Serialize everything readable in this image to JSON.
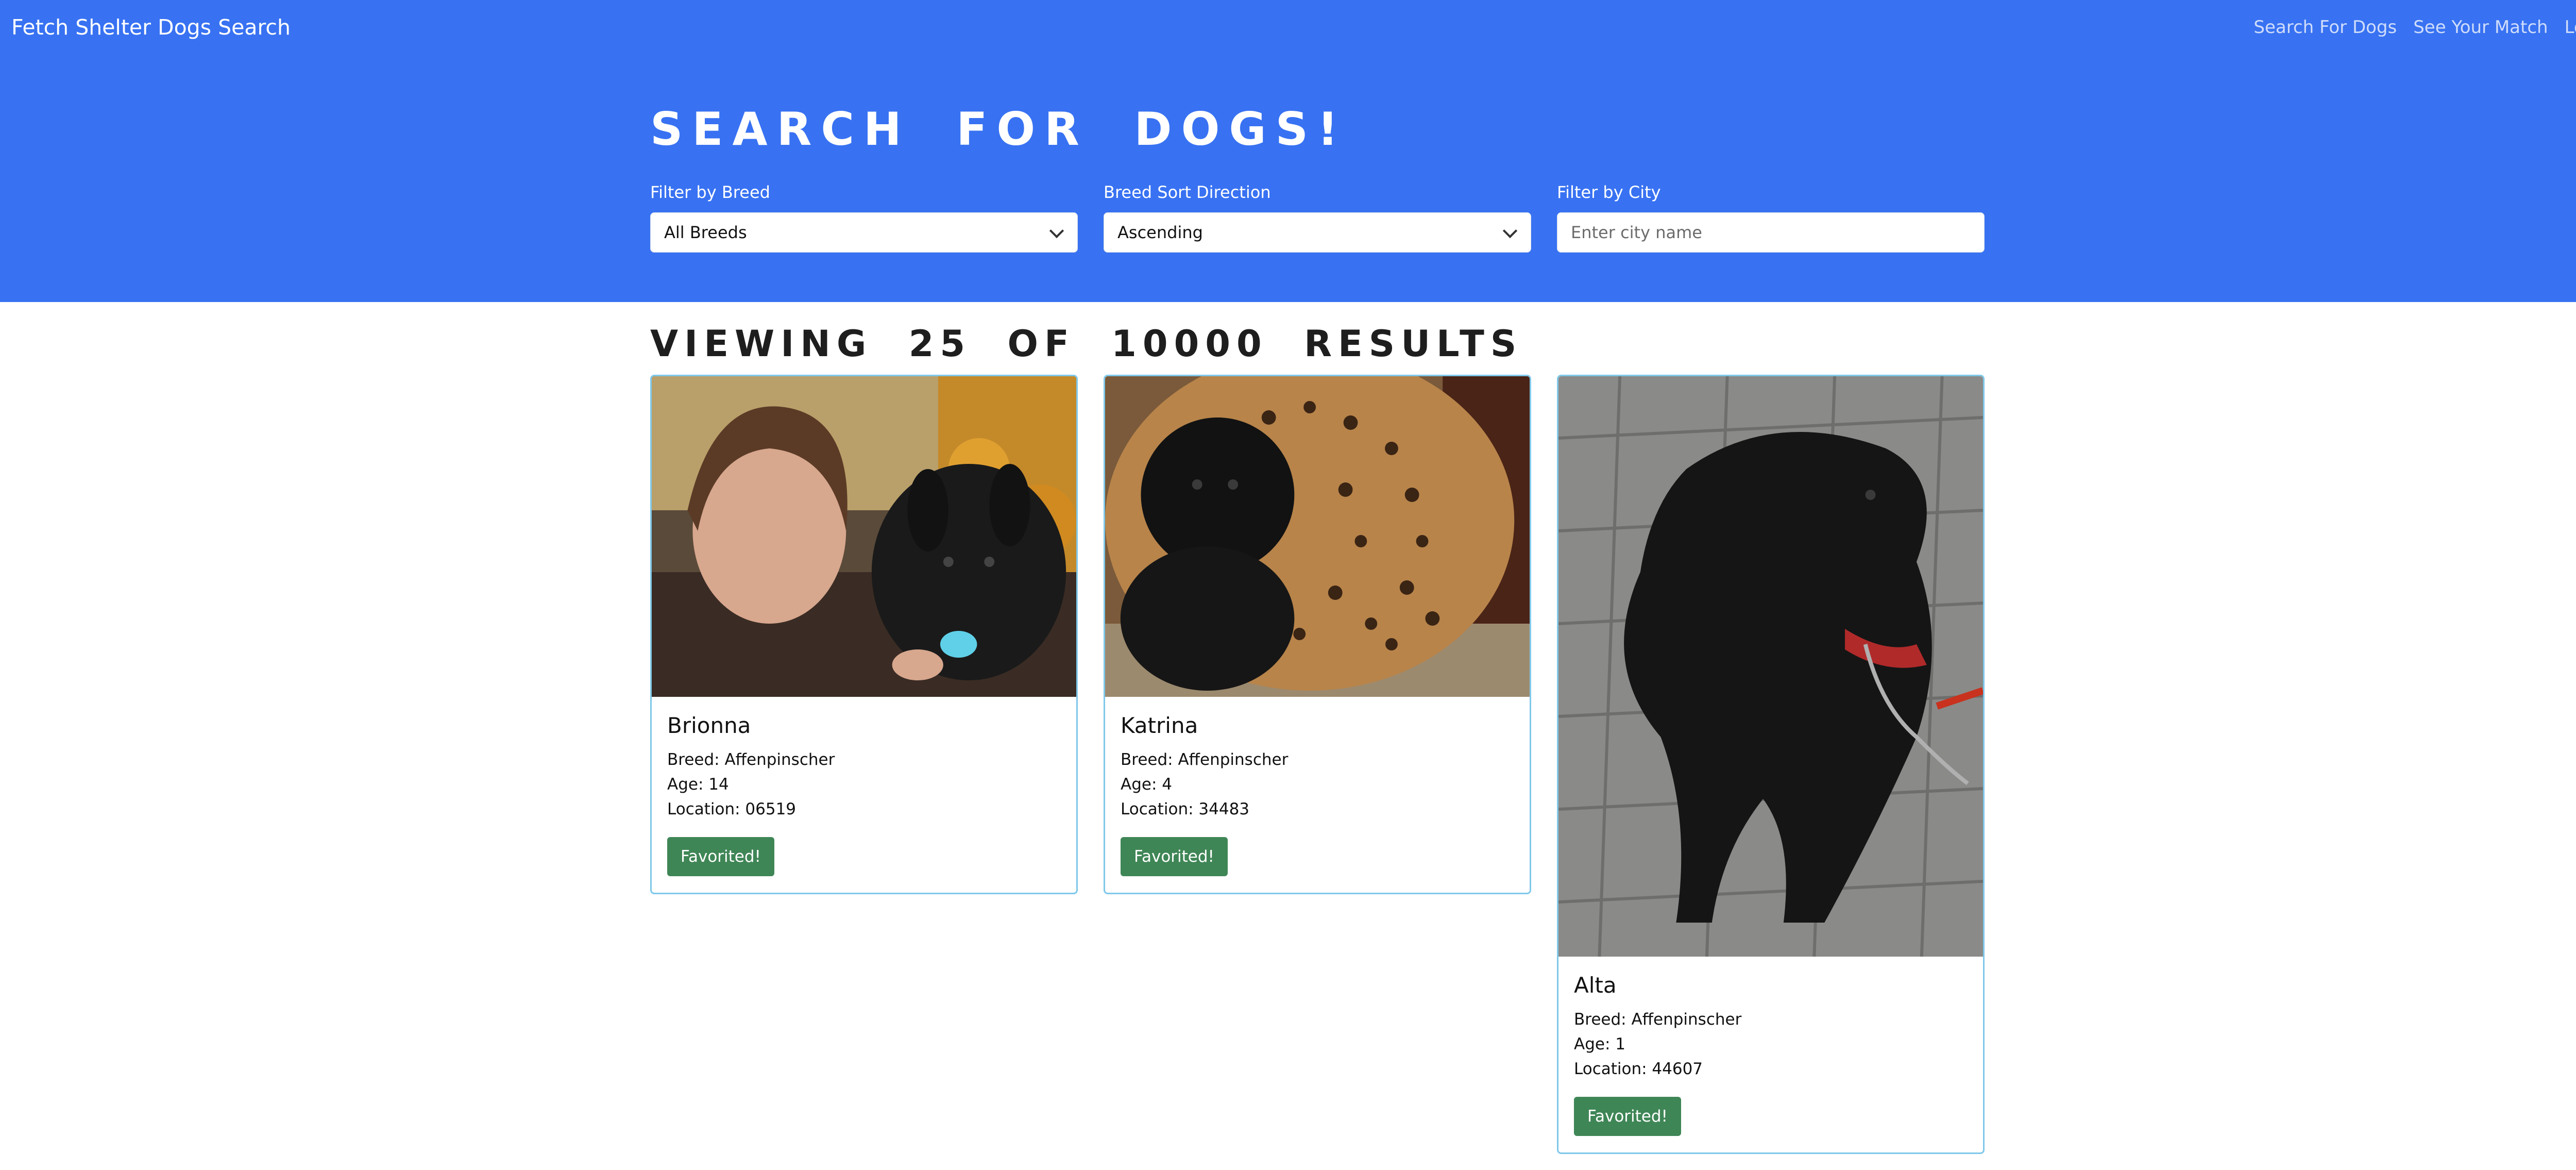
{
  "navbar": {
    "brand": "Fetch Shelter Dogs Search",
    "links": [
      "Search For Dogs",
      "See Your Match",
      "Logout"
    ]
  },
  "search": {
    "title": "Search For Dogs!",
    "filters": {
      "breed": {
        "label": "Filter by Breed",
        "value": "All Breeds"
      },
      "sort": {
        "label": "Breed Sort Direction",
        "value": "Ascending"
      },
      "city": {
        "label": "Filter by City",
        "placeholder": "Enter city name",
        "value": ""
      }
    }
  },
  "results": {
    "heading": "Viewing 25 of 10000 Results",
    "dogs": [
      {
        "name": "Brionna",
        "breed": "Breed: Affenpinscher",
        "age": "Age: 14",
        "location": "Location: 06519",
        "button": "Favorited!"
      },
      {
        "name": "Katrina",
        "breed": "Breed: Affenpinscher",
        "age": "Age: 4",
        "location": "Location: 34483",
        "button": "Favorited!"
      },
      {
        "name": "Alta",
        "breed": "Breed: Affenpinscher",
        "age": "Age: 1",
        "location": "Location: 44607",
        "button": "Favorited!"
      }
    ]
  },
  "colors": {
    "header_bg": "#3872f2",
    "card_border": "#7fc8ea",
    "favorite_button": "#3f8656"
  }
}
